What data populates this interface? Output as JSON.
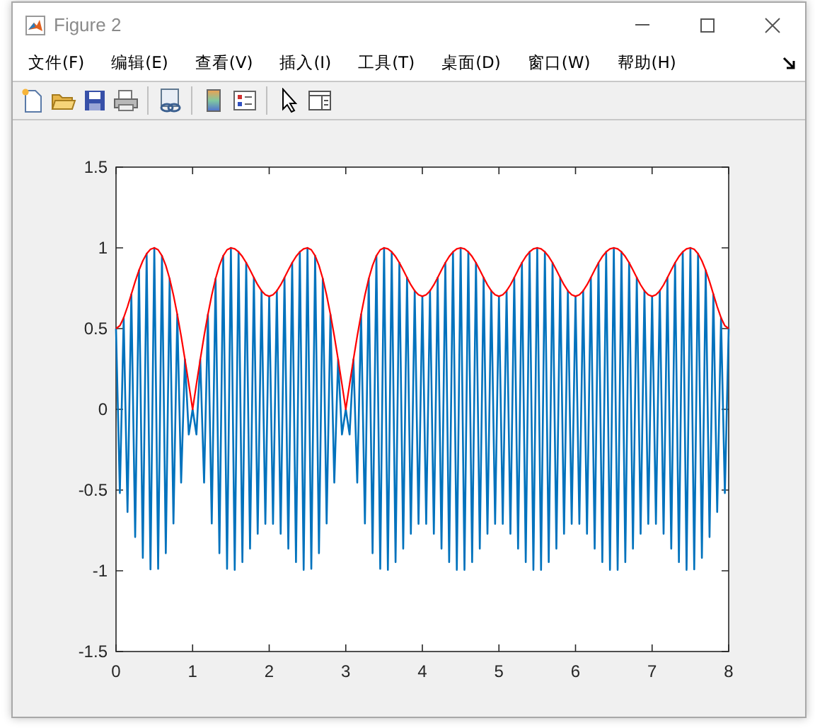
{
  "window": {
    "title": "Figure 2"
  },
  "menu": [
    "文件(F)",
    "编辑(E)",
    "查看(V)",
    "插入(I)",
    "工具(T)",
    "桌面(D)",
    "窗口(W)",
    "帮助(H)"
  ],
  "plot": {
    "chart_data": {
      "type": "line",
      "x": [
        0,
        0.05,
        0.1,
        0.15,
        0.2,
        0.25,
        0.3,
        0.35,
        0.4,
        0.45,
        0.5,
        0.55,
        0.6,
        0.65,
        0.7,
        0.75,
        0.8,
        0.85,
        0.9,
        0.95,
        1,
        1.05,
        1.1,
        1.15,
        1.2,
        1.25,
        1.3,
        1.35,
        1.4,
        1.45,
        1.5,
        1.55,
        1.6,
        1.65,
        1.7,
        1.75,
        1.8,
        1.85,
        1.9,
        1.95,
        2,
        2.05,
        2.1,
        2.15,
        2.2,
        2.25,
        2.3,
        2.35,
        2.4,
        2.45,
        2.5,
        2.55,
        2.6,
        2.65,
        2.7,
        2.75,
        2.8,
        2.85,
        2.9,
        2.95,
        3,
        3.05,
        3.1,
        3.15,
        3.2,
        3.25,
        3.3,
        3.35,
        3.4,
        3.45,
        3.5,
        3.55,
        3.6,
        3.65,
        3.7,
        3.75,
        3.8,
        3.85,
        3.9,
        3.95,
        4,
        4.05,
        4.1,
        4.15,
        4.2,
        4.25,
        4.3,
        4.35,
        4.4,
        4.45,
        4.5,
        4.55,
        4.6,
        4.65,
        4.7,
        4.75,
        4.8,
        4.85,
        4.9,
        4.95,
        5,
        5.05,
        5.1,
        5.15,
        5.2,
        5.25,
        5.3,
        5.35,
        5.4,
        5.45,
        5.5,
        5.55,
        5.6,
        5.65,
        5.7,
        5.75,
        5.8,
        5.85,
        5.9,
        5.95,
        6,
        6.05,
        6.1,
        6.15,
        6.2,
        6.25,
        6.3,
        6.35,
        6.4,
        6.45,
        6.5,
        6.55,
        6.6,
        6.65,
        6.7,
        6.75,
        6.8,
        6.85,
        6.9,
        6.95,
        7,
        7.05,
        7.1,
        7.15,
        7.2,
        7.25,
        7.3,
        7.35,
        7.4,
        7.45,
        7.5,
        7.55,
        7.6,
        7.65,
        7.7,
        7.75,
        7.8,
        7.85,
        7.9,
        7.95,
        8
      ],
      "series": [
        {
          "color": "#0072bd",
          "values": [
            0.5,
            -0.518,
            0.567,
            -0.636,
            0.713,
            -0.791,
            0.861,
            -0.92,
            0.964,
            -0.991,
            1,
            -0.988,
            0.951,
            -0.891,
            0.809,
            -0.707,
            0.588,
            -0.454,
            0.309,
            -0.156,
            0,
            -0.156,
            0.309,
            -0.454,
            0.588,
            -0.707,
            0.809,
            -0.891,
            0.951,
            -0.988,
            1,
            -0.994,
            0.975,
            -0.946,
            0.908,
            -0.863,
            0.816,
            -0.771,
            0.734,
            -0.709,
            0.7,
            -0.709,
            0.734,
            -0.771,
            0.816,
            -0.863,
            0.908,
            -0.946,
            0.975,
            -0.994,
            1,
            -0.988,
            0.951,
            -0.891,
            0.809,
            -0.707,
            0.588,
            -0.454,
            0.309,
            -0.156,
            0,
            -0.156,
            0.309,
            -0.454,
            0.588,
            -0.707,
            0.809,
            -0.891,
            0.951,
            -0.988,
            1,
            -0.994,
            0.975,
            -0.946,
            0.908,
            -0.863,
            0.816,
            -0.771,
            0.734,
            -0.709,
            0.7,
            -0.709,
            0.734,
            -0.771,
            0.816,
            -0.863,
            0.908,
            -0.946,
            0.975,
            -0.994,
            1,
            -0.994,
            0.975,
            -0.946,
            0.908,
            -0.863,
            0.816,
            -0.771,
            0.734,
            -0.709,
            0.7,
            -0.709,
            0.734,
            -0.771,
            0.816,
            -0.863,
            0.908,
            -0.946,
            0.975,
            -0.994,
            1,
            -0.994,
            0.975,
            -0.946,
            0.908,
            -0.863,
            0.816,
            -0.771,
            0.734,
            -0.709,
            0.7,
            -0.709,
            0.734,
            -0.771,
            0.816,
            -0.863,
            0.908,
            -0.946,
            0.975,
            -0.994,
            1,
            -0.994,
            0.975,
            -0.946,
            0.908,
            -0.863,
            0.816,
            -0.771,
            0.734,
            -0.709,
            0.7,
            -0.709,
            0.734,
            -0.771,
            0.816,
            -0.863,
            0.908,
            -0.946,
            0.975,
            -0.994,
            1,
            -0.991,
            0.964,
            -0.92,
            0.861,
            -0.791,
            0.713,
            -0.636,
            0.567,
            -0.518,
            0.5
          ]
        },
        {
          "color": "#ff0000",
          "values": [
            0.5,
            0.518,
            0.567,
            0.636,
            0.713,
            0.791,
            0.861,
            0.92,
            0.964,
            0.991,
            1,
            0.988,
            0.951,
            0.891,
            0.809,
            0.707,
            0.588,
            0.454,
            0.309,
            0.156,
            0,
            0.156,
            0.309,
            0.454,
            0.588,
            0.707,
            0.809,
            0.891,
            0.951,
            0.988,
            1,
            0.994,
            0.975,
            0.946,
            0.908,
            0.863,
            0.816,
            0.771,
            0.734,
            0.709,
            0.7,
            0.709,
            0.734,
            0.771,
            0.816,
            0.863,
            0.908,
            0.946,
            0.975,
            0.994,
            1,
            0.988,
            0.951,
            0.891,
            0.809,
            0.707,
            0.588,
            0.454,
            0.309,
            0.156,
            0,
            0.156,
            0.309,
            0.454,
            0.588,
            0.707,
            0.809,
            0.891,
            0.951,
            0.988,
            1,
            0.994,
            0.975,
            0.946,
            0.908,
            0.863,
            0.816,
            0.771,
            0.734,
            0.709,
            0.7,
            0.709,
            0.734,
            0.771,
            0.816,
            0.863,
            0.908,
            0.946,
            0.975,
            0.994,
            1,
            0.994,
            0.975,
            0.946,
            0.908,
            0.863,
            0.816,
            0.771,
            0.734,
            0.709,
            0.7,
            0.709,
            0.734,
            0.771,
            0.816,
            0.863,
            0.908,
            0.946,
            0.975,
            0.994,
            1,
            0.994,
            0.975,
            0.946,
            0.908,
            0.863,
            0.816,
            0.771,
            0.734,
            0.709,
            0.7,
            0.709,
            0.734,
            0.771,
            0.816,
            0.863,
            0.908,
            0.946,
            0.975,
            0.994,
            1,
            0.994,
            0.975,
            0.946,
            0.908,
            0.863,
            0.816,
            0.771,
            0.734,
            0.709,
            0.7,
            0.709,
            0.734,
            0.771,
            0.816,
            0.863,
            0.908,
            0.946,
            0.975,
            0.994,
            1,
            0.991,
            0.964,
            0.92,
            0.861,
            0.791,
            0.713,
            0.636,
            0.567,
            0.518,
            0.5
          ]
        }
      ],
      "xlim": [
        0,
        8
      ],
      "ylim": [
        -1.5,
        1.5
      ],
      "xticks": [
        0,
        1,
        2,
        3,
        4,
        5,
        6,
        7,
        8
      ],
      "yticks": [
        -1.5,
        -1,
        -0.5,
        0,
        0.5,
        1,
        1.5
      ]
    }
  }
}
